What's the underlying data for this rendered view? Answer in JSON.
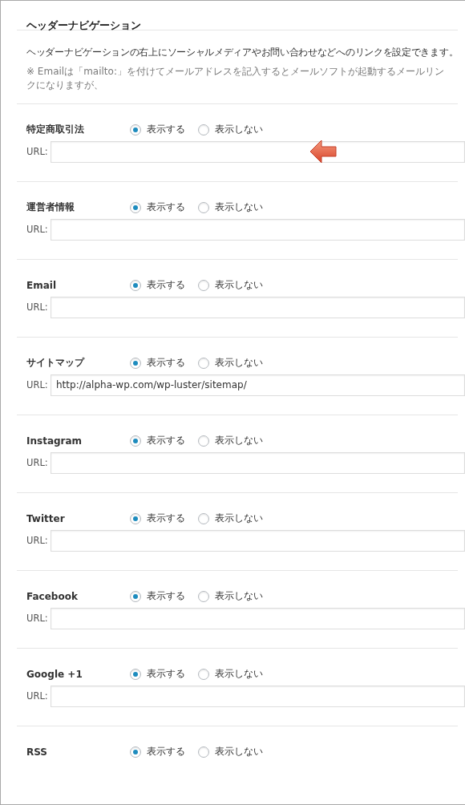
{
  "title": "ヘッダーナビゲーション",
  "description": "ヘッダーナビゲーションの右上にソーシャルメディアやお問い合わせなどへのリンクを設定できます。",
  "note": "※ Emailは「mailto:」を付けてメールアドレスを記入するとメールソフトが起動するメールリンクになりますが、",
  "sections": [
    {
      "label": "特定商取引法",
      "options": [
        {
          "label": "表示する",
          "selected": true
        },
        {
          "label": "表示しない",
          "selected": false
        }
      ],
      "url_label": "URL:",
      "arrow": true
    },
    {
      "label": "運営者情報",
      "options": [
        {
          "label": "表示する",
          "selected": true
        },
        {
          "label": "表示しない",
          "selected": false
        }
      ],
      "url_label": "URL:"
    },
    {
      "label": "Email",
      "options": [
        {
          "label": "表示する",
          "selected": true
        },
        {
          "label": "表示しない",
          "selected": false
        }
      ],
      "url_label": "URL:"
    },
    {
      "label": "サイトマップ",
      "options": [
        {
          "label": "表示する",
          "selected": true
        },
        {
          "label": "表示しない",
          "selected": false
        }
      ],
      "url_label": "URL:",
      "url": "http://alpha-wp.com/wp-luster/sitemap/"
    },
    {
      "label": "Instagram",
      "options": [
        {
          "label": "表示する",
          "selected": true
        },
        {
          "label": "表示しない",
          "selected": false
        }
      ],
      "url_label": "URL:"
    },
    {
      "label": "Twitter",
      "options": [
        {
          "label": "表示する",
          "selected": true
        },
        {
          "label": "表示しない",
          "selected": false
        }
      ],
      "url_label": "URL:"
    },
    {
      "label": "Facebook",
      "options": [
        {
          "label": "表示する",
          "selected": true
        },
        {
          "label": "表示しない",
          "selected": false
        }
      ],
      "url_label": "URL:"
    },
    {
      "label": "Google +1",
      "options": [
        {
          "label": "表示する",
          "selected": true
        },
        {
          "label": "表示しない",
          "selected": false
        }
      ],
      "url_label": "URL:"
    },
    {
      "label": "RSS",
      "options": [
        {
          "label": "表示する",
          "selected": true
        },
        {
          "label": "表示しない",
          "selected": false
        }
      ]
    }
  ]
}
